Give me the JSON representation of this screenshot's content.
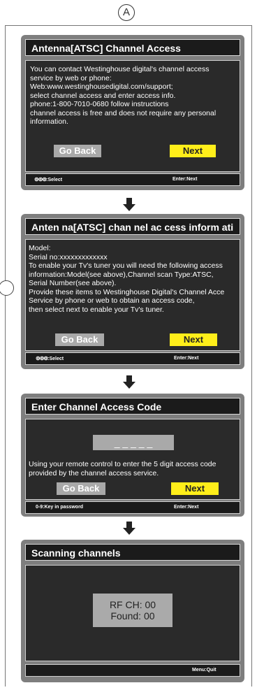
{
  "figure_marker": "A",
  "screens": {
    "s1": {
      "title": "Antenna[ATSC] Channel Access",
      "body_lines": [
        "You can contact Westinghouse digital's channel access",
        "service by web or phone:",
        "Web:www.westinghousedigital.com/support;",
        "select channel access and enter access info.",
        "phone:1-800-7010-0680 follow instructions",
        "channel access is free and does not require any personal",
        "information."
      ],
      "back_label": "Go Back",
      "next_label": "Next",
      "status_left_icon": "⊚⊚⊚",
      "status_left_label": ":Select",
      "status_right_label": "Enter:Next"
    },
    "s2": {
      "title": "Anten na[ATSC] chan nel ac cess inform ati on",
      "body_lines": [
        "Model:",
        "Serial no:xxxxxxxxxxxxx",
        "To enable your Tv's tuner you will need the following access",
        "information:Model(see above),Channel scan Type:ATSC,",
        "Serial Number(see above).",
        "Provide these items to Westinghouse Digital's Channel Acce",
        "Service by phone or web to obtain an access code,",
        "then select next to enable your Tv's tuner."
      ],
      "back_label": "Go Back",
      "next_label": "Next",
      "status_left_icon": "⊚⊚⊚",
      "status_left_label": ":Select",
      "status_right_label": "Enter:Next"
    },
    "s3": {
      "title": "Enter Channel Access Code",
      "code_value": "_ _ _ _ _",
      "body_lines": [
        "Using your remote control to enter the 5 digit access code",
        "provided by the channel access service."
      ],
      "back_label": "Go Back",
      "next_label": "Next",
      "status_left_label": "0-9:Key in password",
      "status_right_label": "Enter:Next"
    },
    "s4": {
      "title": "Scanning channels",
      "rf_line": "RF CH: 00",
      "found_line": "Found: 00",
      "status_right_label": "Menu:Quit"
    }
  },
  "colors": {
    "panel_gray": "#7e7e7e",
    "next_yellow": "#ffee1a",
    "back_gray": "#a9a9a9",
    "title_bar": "#1b1b1b"
  }
}
